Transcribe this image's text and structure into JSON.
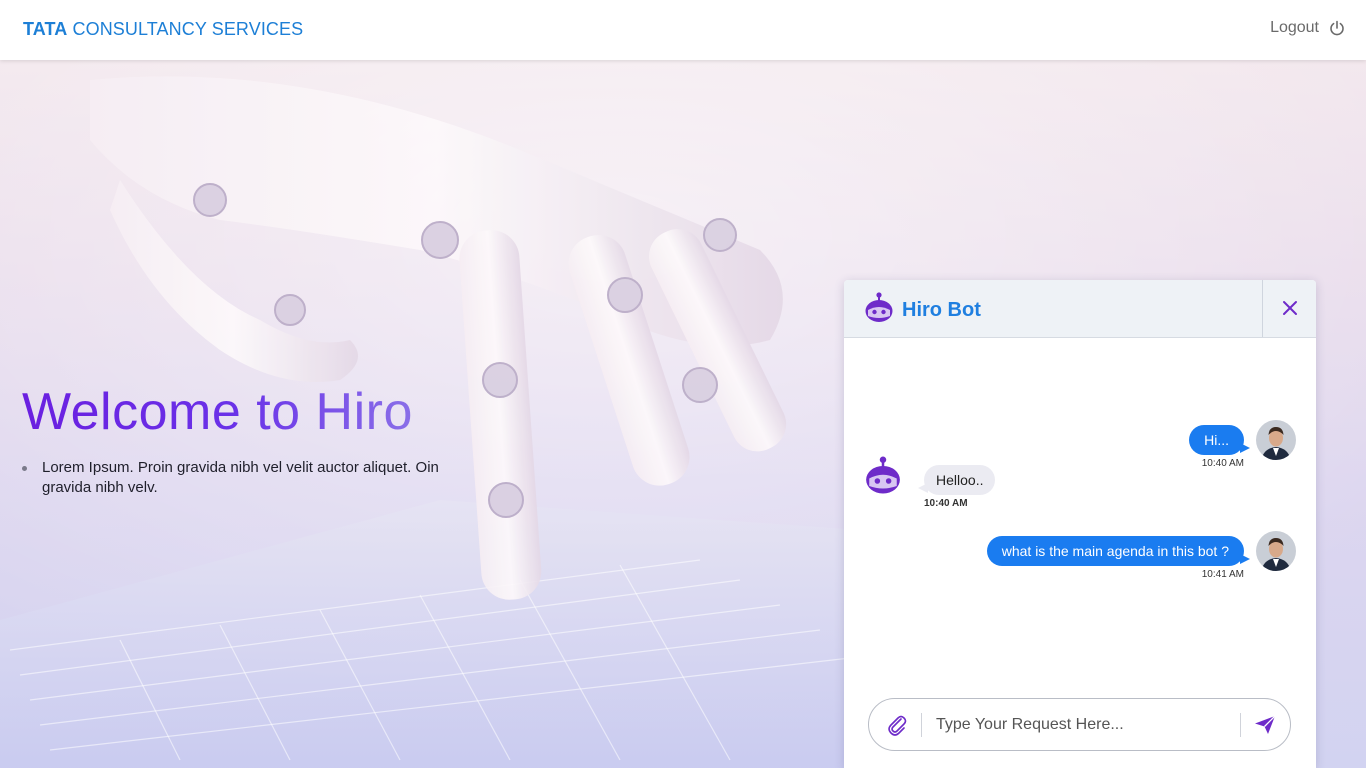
{
  "header": {
    "logo_bold": "TATA",
    "logo_rest": "CONSULTANCY SERVICES",
    "logout_label": "Logout",
    "logout_icon": "power-icon"
  },
  "hero": {
    "title": "Welcome to Hiro",
    "bullets": [
      "Lorem Ipsum. Proin gravida nibh vel velit auctor aliquet. Oin gravida nibh velv."
    ]
  },
  "chat": {
    "title": "Hiro Bot",
    "bot_icon": "robot-icon",
    "close_icon": "close-icon",
    "messages": [
      {
        "from": "user",
        "text": "Hi...",
        "time": "10:40 AM"
      },
      {
        "from": "bot",
        "text": "Helloo..",
        "time": "10:40 AM"
      },
      {
        "from": "user",
        "text": "what is the main agenda in this bot ?",
        "time": "10:41 AM"
      }
    ],
    "input": {
      "placeholder": "Type Your Request Here...",
      "value": "",
      "attach_icon": "paperclip-icon",
      "send_icon": "send-icon"
    }
  },
  "colors": {
    "brand_blue": "#1d7fd6",
    "user_bubble": "#1a7cf0",
    "bot_bubble": "#ebebf2",
    "bot_purple": "#6e2bc9",
    "welcome_gradient": [
      "#6a1fe0",
      "#8a6fe8"
    ]
  }
}
